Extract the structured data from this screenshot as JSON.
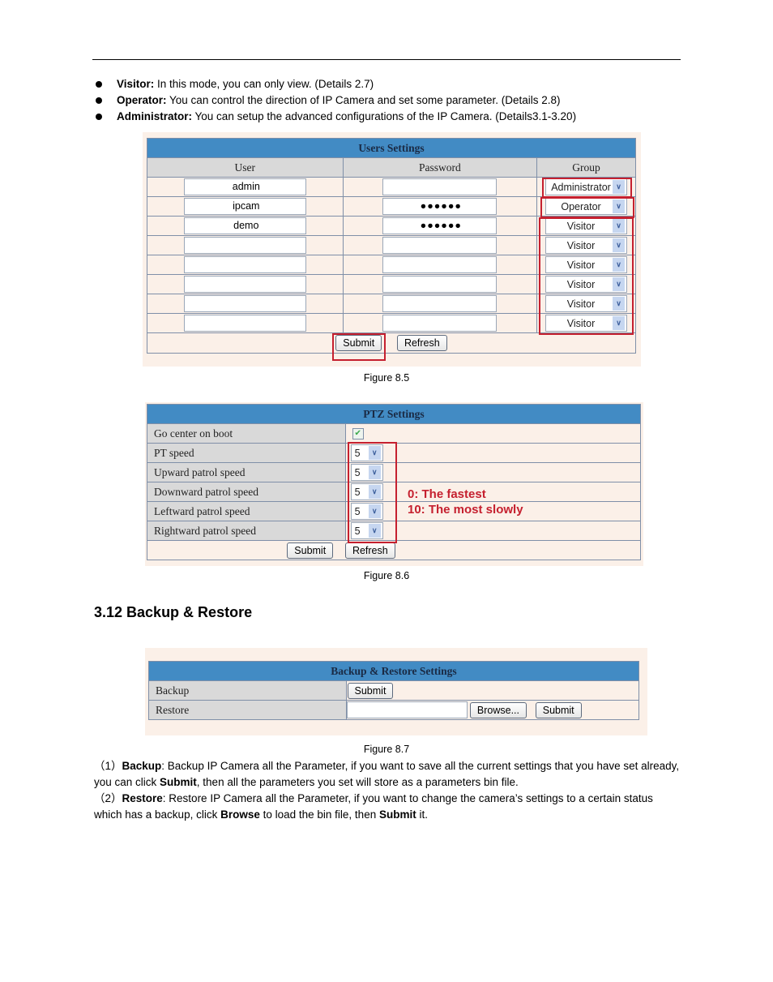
{
  "bullets": [
    {
      "term": "Visitor:",
      "text": " In this mode, you can only view. (Details 2.7)"
    },
    {
      "term": "Operator:",
      "text": " You can control the direction of IP Camera and set some parameter. (Details 2.8)"
    },
    {
      "term": "Administrator:",
      "text": " You can setup the advanced configurations of the IP Camera. (Details3.1-3.20)"
    }
  ],
  "users_settings": {
    "title": "Users Settings",
    "columns": [
      "User",
      "Password",
      "Group"
    ],
    "rows": [
      {
        "user": "admin",
        "password": "",
        "group": "Administrator"
      },
      {
        "user": "ipcam",
        "password": "●●●●●●",
        "group": "Operator"
      },
      {
        "user": "demo",
        "password": "●●●●●●",
        "group": "Visitor"
      },
      {
        "user": "",
        "password": "",
        "group": "Visitor"
      },
      {
        "user": "",
        "password": "",
        "group": "Visitor"
      },
      {
        "user": "",
        "password": "",
        "group": "Visitor"
      },
      {
        "user": "",
        "password": "",
        "group": "Visitor"
      },
      {
        "user": "",
        "password": "",
        "group": "Visitor"
      }
    ],
    "submit_label": "Submit",
    "refresh_label": "Refresh",
    "caption": "Figure 8.5"
  },
  "ptz_settings": {
    "title": "PTZ Settings",
    "go_center_label": "Go center on boot",
    "go_center_checked": true,
    "speeds": [
      {
        "label": "PT speed",
        "value": "5"
      },
      {
        "label": "Upward patrol speed",
        "value": "5"
      },
      {
        "label": "Downward patrol speed",
        "value": "5"
      },
      {
        "label": "Leftward patrol speed",
        "value": "5"
      },
      {
        "label": "Rightward patrol speed",
        "value": "5"
      }
    ],
    "note_line1": "0:  The fastest",
    "note_line2": "10: The most slowly",
    "submit_label": "Submit",
    "refresh_label": "Refresh",
    "caption": "Figure 8.6"
  },
  "section_heading": "3.12 Backup & Restore",
  "backup_restore": {
    "title": "Backup & Restore Settings",
    "backup_label": "Backup",
    "backup_submit_label": "Submit",
    "restore_label": "Restore",
    "restore_file_value": "",
    "browse_label": "Browse...",
    "restore_submit_label": "Submit",
    "caption": "Figure 8.7"
  },
  "paragraphs": {
    "p1": {
      "prefix": "（1）",
      "term": "Backup",
      "text1": ": Backup IP Camera all the Parameter, if you want to save all the current settings that you have set already, you can click ",
      "bold2": "Submit",
      "text2": ", then all the parameters you set will store as a parameters bin file."
    },
    "p2": {
      "prefix": "（2）",
      "term": "Restore",
      "text1": ": Restore IP Camera all the Parameter, if you want to change the camera’s settings to a certain status which has a backup, click ",
      "bold2": "Browse",
      "text2": " to load the bin file, then ",
      "bold3": "Submit",
      "text3": " it."
    }
  }
}
